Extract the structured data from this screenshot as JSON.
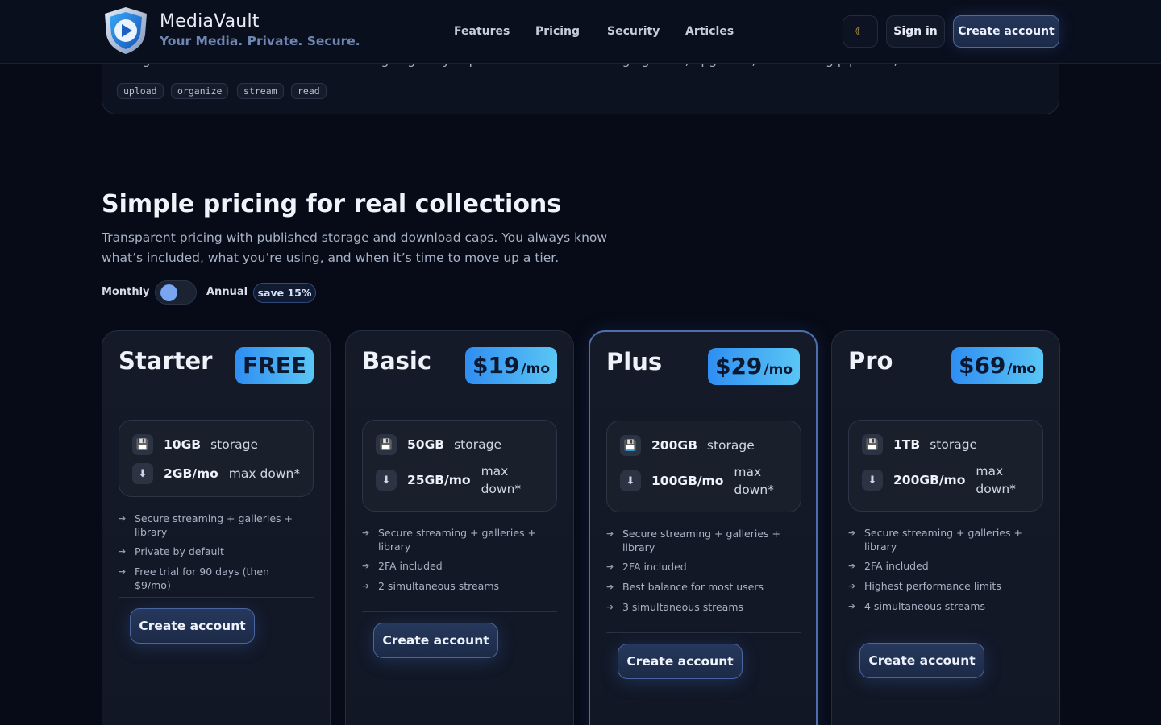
{
  "header": {
    "brand_name": "MediaVault",
    "tagline": "Your Media. Private. Secure.",
    "nav": [
      "Features",
      "Pricing",
      "Security",
      "Articles"
    ],
    "theme_icon": "☾",
    "sign_in": "Sign in",
    "create_account": "Create account"
  },
  "previous_section": {
    "text": "You get the benefits of a modern streaming + gallery experience—without managing disks, upgrades, transcoding pipelines, or remote access.",
    "tags": [
      "upload",
      "organize",
      "stream",
      "read"
    ]
  },
  "pricing": {
    "title": "Simple pricing for real collections",
    "subtitle": "Transparent pricing with published storage and download caps. You always know what’s included, what you’re using, and when it’s time to move up a tier.",
    "monthly_label": "Monthly",
    "annual_label": "Annual",
    "save_badge": "save 15%",
    "plans": [
      {
        "name": "Starter",
        "price": "FREE",
        "per": "",
        "storage_value": "10GB",
        "storage_label": "storage",
        "down_value": "2GB/mo",
        "down_label": "max down*",
        "features": [
          "Secure streaming + galleries + library",
          "Private by default",
          "Free trial for 90 days (then $9/mo)"
        ],
        "cta": "Create account"
      },
      {
        "name": "Basic",
        "price": "$19",
        "per": "/mo",
        "storage_value": "50GB",
        "storage_label": "storage",
        "down_value": "25GB/mo",
        "down_label": "max down*",
        "features": [
          "Secure streaming + galleries + library",
          "2FA included",
          "2 simultaneous streams"
        ],
        "cta": "Create account"
      },
      {
        "name": "Plus",
        "price": "$29",
        "per": "/mo",
        "storage_value": "200GB",
        "storage_label": "storage",
        "down_value": "100GB/mo",
        "down_label": "max down*",
        "features": [
          "Secure streaming + galleries + library",
          "2FA included",
          "Best balance for most users",
          "3 simultaneous streams"
        ],
        "cta": "Create account"
      },
      {
        "name": "Pro",
        "price": "$69",
        "per": "/mo",
        "storage_value": "1TB",
        "storage_label": "storage",
        "down_value": "200GB/mo",
        "down_label": "max down*",
        "features": [
          "Secure streaming + galleries + library",
          "2FA included",
          "Highest performance limits",
          "4 simultaneous streams"
        ],
        "cta": "Create account"
      }
    ]
  },
  "icons": {
    "storage": "floppy-disk-icon",
    "download": "download-arrow-icon",
    "feature_bullet": "arrow-right-icon"
  }
}
